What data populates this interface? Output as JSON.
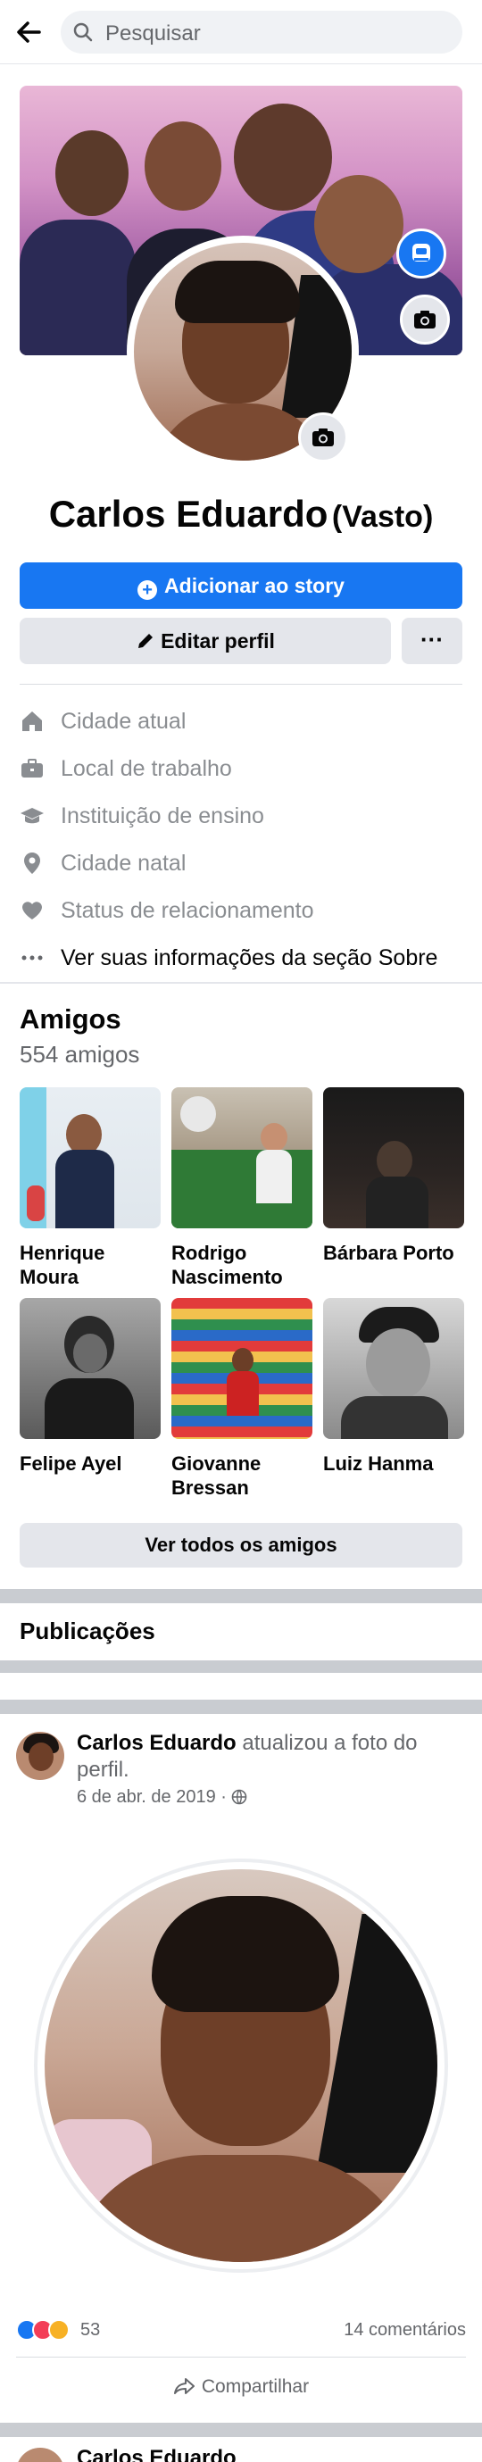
{
  "search": {
    "placeholder": "Pesquisar"
  },
  "profile": {
    "name": "Carlos Eduardo",
    "alt_name": "(Vasto)",
    "add_story_label": "Adicionar ao story",
    "edit_profile_label": "Editar perfil",
    "more_label": "···"
  },
  "about": {
    "items": [
      {
        "icon": "house-icon",
        "label": "Cidade atual"
      },
      {
        "icon": "briefcase-icon",
        "label": "Local de trabalho"
      },
      {
        "icon": "graduation-cap-icon",
        "label": "Instituição de ensino"
      },
      {
        "icon": "location-pin-icon",
        "label": "Cidade natal"
      },
      {
        "icon": "heart-icon",
        "label": "Status de relacionamento"
      },
      {
        "icon": "more-dots-icon",
        "label": "Ver suas informações da seção Sobre"
      }
    ]
  },
  "friends": {
    "title": "Amigos",
    "count": "554 amigos",
    "items": [
      {
        "name": "Henrique Moura"
      },
      {
        "name": "Rodrigo Nascimento"
      },
      {
        "name": "Bárbara Porto"
      },
      {
        "name": "Felipe Ayel"
      },
      {
        "name": "Giovanne Bressan"
      },
      {
        "name": "Luiz Hanma"
      }
    ],
    "see_all_label": "Ver todos os amigos"
  },
  "publications": {
    "title": "Publicações"
  },
  "post": {
    "author": "Carlos Eduardo",
    "action": "atualizou a foto do perfil.",
    "date": "6 de abr. de 2019 ·",
    "reactions_count": "53",
    "comments": "14 comentários",
    "share_label": "Compartilhar"
  },
  "next_post": {
    "author": "Carlos Eduardo"
  },
  "colors": {
    "brand_blue": "#1877f2",
    "gray_button": "#e4e6eb",
    "like": "#1877f2",
    "love": "#f33e58",
    "wow": "#f7b125"
  }
}
